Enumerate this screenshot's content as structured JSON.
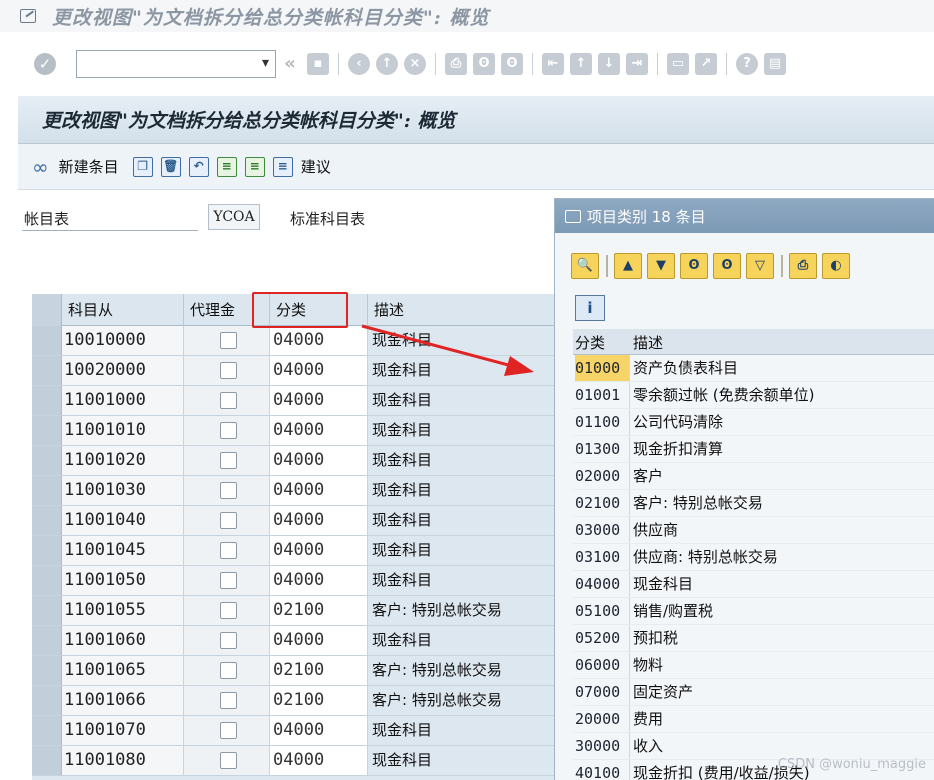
{
  "window": {
    "title": "更改视图\"为文档拆分给总分类帐科目分类\": 概览"
  },
  "std_toolbar": {
    "command_field": {
      "value": ""
    },
    "icons": [
      "check-icon",
      "back-icon",
      "exit-icon",
      "cancel-icon",
      "print-icon",
      "find-icon",
      "find-next-icon",
      "first-page-icon",
      "prev-page-icon",
      "next-page-icon",
      "last-page-icon",
      "new-session-icon",
      "shortcut-icon",
      "help-icon",
      "layout-icon"
    ]
  },
  "screen": {
    "header": "更改视图\"为文档拆分给总分类帐科目分类\": 概览",
    "toolbar": {
      "new_entries": "新建条目",
      "proposal": "建议"
    },
    "chart_of_accounts": {
      "label": "帐目表",
      "value": "YCOA",
      "description": "标准科目表"
    },
    "table": {
      "headers": {
        "account_from": "科目从",
        "reconciliation": "代理金",
        "category": "分类",
        "description": "描述"
      },
      "rows": [
        {
          "account": "10010000",
          "category": "04000",
          "description": "现金科目"
        },
        {
          "account": "10020000",
          "category": "04000",
          "description": "现金科目"
        },
        {
          "account": "11001000",
          "category": "04000",
          "description": "现金科目"
        },
        {
          "account": "11001010",
          "category": "04000",
          "description": "现金科目"
        },
        {
          "account": "11001020",
          "category": "04000",
          "description": "现金科目"
        },
        {
          "account": "11001030",
          "category": "04000",
          "description": "现金科目"
        },
        {
          "account": "11001040",
          "category": "04000",
          "description": "现金科目"
        },
        {
          "account": "11001045",
          "category": "04000",
          "description": "现金科目"
        },
        {
          "account": "11001050",
          "category": "04000",
          "description": "现金科目"
        },
        {
          "account": "11001055",
          "category": "02100",
          "description": "客户: 特别总帐交易"
        },
        {
          "account": "11001060",
          "category": "04000",
          "description": "现金科目"
        },
        {
          "account": "11001065",
          "category": "02100",
          "description": "客户: 特别总帐交易"
        },
        {
          "account": "11001066",
          "category": "02100",
          "description": "客户: 特别总帐交易"
        },
        {
          "account": "11001070",
          "category": "04000",
          "description": "现金科目"
        },
        {
          "account": "11001080",
          "category": "04000",
          "description": "现金科目"
        }
      ]
    }
  },
  "popup": {
    "title": "项目类别 18 条目",
    "list_headers": {
      "category": "分类",
      "description": "描述"
    },
    "items": [
      {
        "code": "01000",
        "desc": "资产负债表科目"
      },
      {
        "code": "01001",
        "desc": "零余额过帐 (免费余额单位)"
      },
      {
        "code": "01100",
        "desc": "公司代码清除"
      },
      {
        "code": "01300",
        "desc": "现金折扣清算"
      },
      {
        "code": "02000",
        "desc": "客户"
      },
      {
        "code": "02100",
        "desc": "客户: 特别总帐交易"
      },
      {
        "code": "03000",
        "desc": "供应商"
      },
      {
        "code": "03100",
        "desc": "供应商: 特别总帐交易"
      },
      {
        "code": "04000",
        "desc": "现金科目"
      },
      {
        "code": "05100",
        "desc": "销售/购置税"
      },
      {
        "code": "05200",
        "desc": "预扣税"
      },
      {
        "code": "06000",
        "desc": "物料"
      },
      {
        "code": "07000",
        "desc": "固定资产"
      },
      {
        "code": "20000",
        "desc": "费用"
      },
      {
        "code": "30000",
        "desc": "收入"
      },
      {
        "code": "40100",
        "desc": "现金折扣 (费用/收益/损失)"
      }
    ]
  },
  "watermark": "CSDN @woniu_maggie",
  "colors": {
    "highlight_box": "#e02424",
    "selected_code": "#f7d468",
    "popup_title": "#7c99b5"
  }
}
